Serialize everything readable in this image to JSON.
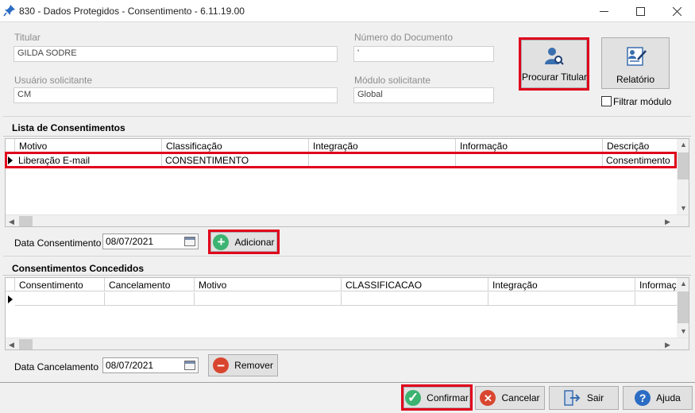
{
  "window": {
    "title": "830 - Dados Protegidos - Consentimento - 6.11.19.00"
  },
  "form": {
    "titular_label": "Titular",
    "titular_value": "GILDA SODRE",
    "numero_label": "Número do Documento",
    "numero_value": "'",
    "usuario_label": "Usuário solicitante",
    "usuario_value": "CM",
    "modulo_label": "Módulo solicitante",
    "modulo_value": "Global",
    "procurar_label": "Procurar Titular",
    "relatorio_label": "Relatório",
    "filtrar_label": "Filtrar módulo",
    "filtrar_checked": false
  },
  "lista": {
    "heading": "Lista de Consentimentos",
    "columns": [
      "Motivo",
      "Classificação",
      "Integração",
      "Informação",
      "Descrição"
    ],
    "rows": [
      [
        "Liberação E-mail",
        "CONSENTIMENTO",
        "",
        "",
        "Consentimento"
      ]
    ],
    "data_label": "Data Consentimento",
    "data_value": "08/07/2021",
    "adicionar_label": "Adicionar"
  },
  "concedidos": {
    "heading": "Consentimentos Concedidos",
    "columns": [
      "Consentimento",
      "Cancelamento",
      "Motivo",
      "CLASSIFICACAO",
      "Integração",
      "Informação"
    ],
    "data_label": "Data Cancelamento",
    "data_value": "08/07/2021",
    "remover_label": "Remover"
  },
  "footer": {
    "confirmar_label": "Confirmar",
    "cancelar_label": "Cancelar",
    "sair_label": "Sair",
    "ajuda_label": "Ajuda"
  },
  "colors": {
    "highlight": "#e0001b",
    "icon_blue": "#3a6fb0",
    "add_green": "#3cb371",
    "remove_red": "#d9462f"
  }
}
